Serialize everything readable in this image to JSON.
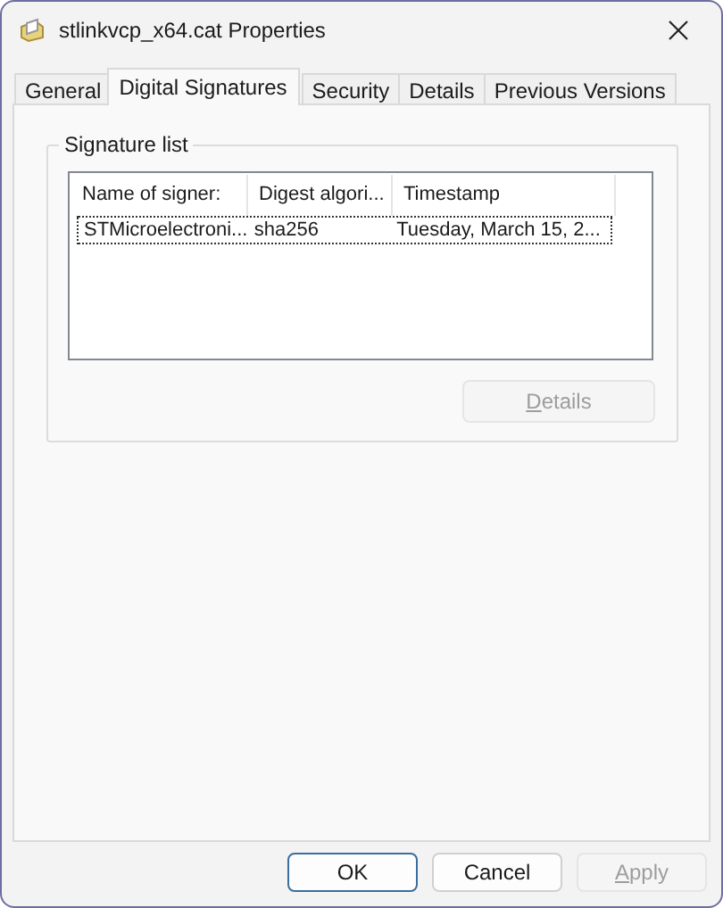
{
  "window": {
    "title": "stlinkvcp_x64.cat Properties"
  },
  "tabs": [
    {
      "label": "General",
      "selected": false
    },
    {
      "label": "Digital Signatures",
      "selected": true
    },
    {
      "label": "Security",
      "selected": false
    },
    {
      "label": "Details",
      "selected": false
    },
    {
      "label": "Previous Versions",
      "selected": false
    }
  ],
  "group": {
    "title": "Signature list"
  },
  "table": {
    "columns": [
      "Name of signer:",
      "Digest algori...",
      "Timestamp"
    ],
    "rows": [
      {
        "cells": [
          "STMicroelectroni...",
          "sha256",
          "Tuesday, March 15, 2..."
        ],
        "selected": true
      }
    ]
  },
  "details_button": {
    "label": "Details",
    "access_key_underlined": true,
    "disabled": true
  },
  "buttons": [
    {
      "label": "OK",
      "kind": "default",
      "disabled": false
    },
    {
      "label": "Cancel",
      "kind": "normal",
      "disabled": false
    },
    {
      "label": "Apply",
      "kind": "normal",
      "disabled": true,
      "access_key_underlined": true
    }
  ]
}
